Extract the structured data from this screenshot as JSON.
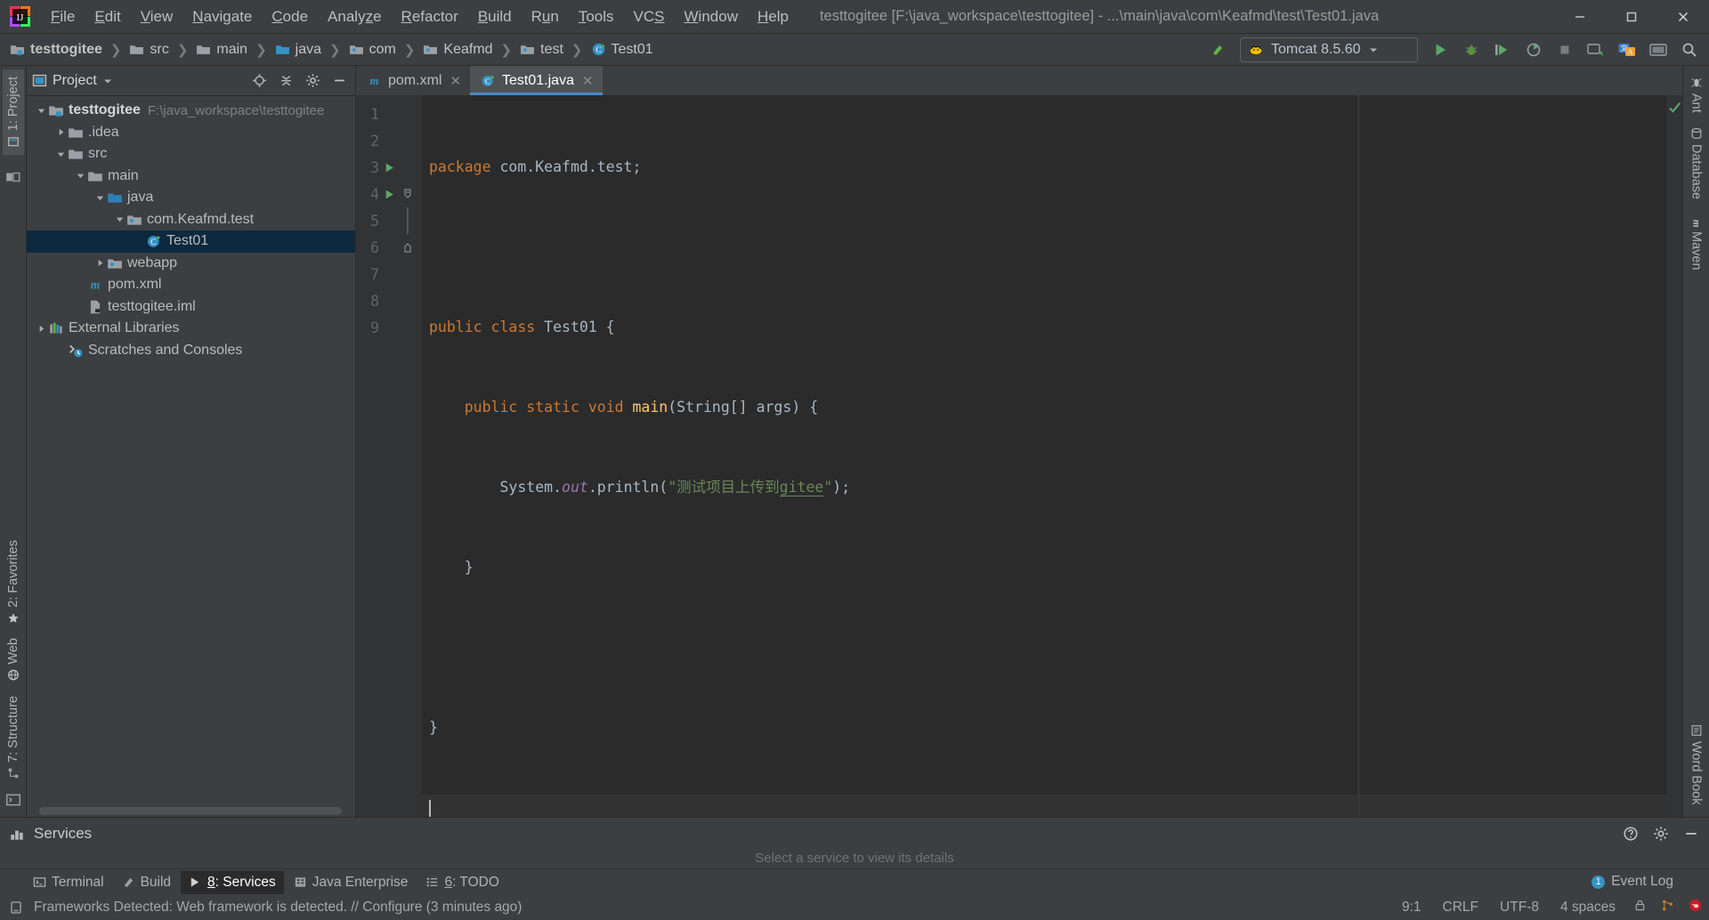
{
  "window": {
    "title": "testtogitee [F:\\java_workspace\\testtogitee] - ...\\main\\java\\com\\Keafmd\\test\\Test01.java",
    "minimize": "—",
    "maximize": "❐",
    "close": "✕"
  },
  "menu": [
    {
      "label": "File",
      "mnemonic": "F"
    },
    {
      "label": "Edit",
      "mnemonic": "E"
    },
    {
      "label": "View",
      "mnemonic": "V"
    },
    {
      "label": "Navigate",
      "mnemonic": "N"
    },
    {
      "label": "Code",
      "mnemonic": "C"
    },
    {
      "label": "Analyze",
      "mnemonic": "z"
    },
    {
      "label": "Refactor",
      "mnemonic": "R"
    },
    {
      "label": "Build",
      "mnemonic": "B"
    },
    {
      "label": "Run",
      "mnemonic": "u"
    },
    {
      "label": "Tools",
      "mnemonic": "T"
    },
    {
      "label": "VCS",
      "mnemonic": "S"
    },
    {
      "label": "Window",
      "mnemonic": "W"
    },
    {
      "label": "Help",
      "mnemonic": "H"
    }
  ],
  "breadcrumb": [
    {
      "label": "testtogitee",
      "icon": "module-icon",
      "bold": true
    },
    {
      "label": "src",
      "icon": "folder-icon",
      "bold": false
    },
    {
      "label": "main",
      "icon": "folder-icon",
      "bold": false
    },
    {
      "label": "java",
      "icon": "source-folder-icon",
      "bold": false
    },
    {
      "label": "com",
      "icon": "package-icon",
      "bold": false
    },
    {
      "label": "Keafmd",
      "icon": "package-icon",
      "bold": false
    },
    {
      "label": "test",
      "icon": "package-icon",
      "bold": false
    },
    {
      "label": "Test01",
      "icon": "java-class-icon",
      "bold": false
    }
  ],
  "toolbar": {
    "build_label": "make-project-icon",
    "run_config": "Tomcat 8.5.60",
    "run_label": "run-icon",
    "debug_label": "debug-icon",
    "run_coverage_label": "run-with-coverage-icon",
    "profile_label": "profile-icon",
    "stop_label": "stop-icon",
    "update_label": "update-app-icon",
    "translate_label": "translate-icon",
    "present_label": "present-icon",
    "search_label": "search-everywhere-icon"
  },
  "project_panel": {
    "title": "Project",
    "buttons": [
      "locate-icon",
      "collapse-all-icon",
      "gear-icon",
      "hide-icon"
    ],
    "tree": [
      {
        "depth": 0,
        "label": "testtogitee",
        "sub": "F:\\java_workspace\\testtogitee",
        "icon": "module-icon",
        "arrow": "down",
        "bold": true,
        "selected": false
      },
      {
        "depth": 1,
        "label": ".idea",
        "sub": "",
        "icon": "folder-icon",
        "arrow": "right",
        "bold": false,
        "selected": false
      },
      {
        "depth": 1,
        "label": "src",
        "sub": "",
        "icon": "folder-icon",
        "arrow": "down",
        "bold": false,
        "selected": false
      },
      {
        "depth": 2,
        "label": "main",
        "sub": "",
        "icon": "folder-icon",
        "arrow": "down",
        "bold": false,
        "selected": false
      },
      {
        "depth": 3,
        "label": "java",
        "sub": "",
        "icon": "source-folder-icon",
        "arrow": "down",
        "bold": false,
        "selected": false
      },
      {
        "depth": 4,
        "label": "com.Keafmd.test",
        "sub": "",
        "icon": "package-icon",
        "arrow": "down",
        "bold": false,
        "selected": false
      },
      {
        "depth": 5,
        "label": "Test01",
        "sub": "",
        "icon": "java-class-icon",
        "arrow": "none",
        "bold": false,
        "selected": true
      },
      {
        "depth": 3,
        "label": "webapp",
        "sub": "",
        "icon": "webapp-folder-icon",
        "arrow": "right",
        "bold": false,
        "selected": false
      },
      {
        "depth": 2,
        "label": "pom.xml",
        "sub": "",
        "icon": "maven-icon",
        "arrow": "none",
        "bold": false,
        "selected": false
      },
      {
        "depth": 2,
        "label": "testtogitee.iml",
        "sub": "",
        "icon": "iml-file-icon",
        "arrow": "none",
        "bold": false,
        "selected": false
      },
      {
        "depth": 0,
        "label": "External Libraries",
        "sub": "",
        "icon": "libraries-icon",
        "arrow": "right",
        "bold": false,
        "selected": false
      },
      {
        "depth": 0,
        "label": "Scratches and Consoles",
        "sub": "",
        "icon": "scratches-icon",
        "arrow": "none",
        "bold": false,
        "selected": false
      }
    ]
  },
  "left_strip": [
    {
      "label": "1: Project",
      "icon": "project-icon",
      "active": true
    },
    {
      "label": "2: Favorites",
      "icon": "favorites-icon",
      "active": false
    },
    {
      "label": "Web",
      "icon": "web-icon",
      "active": false
    },
    {
      "label": "7: Structure",
      "icon": "structure-icon",
      "active": false
    }
  ],
  "right_strip": [
    {
      "label": "Ant",
      "icon": "ant-icon",
      "active": false
    },
    {
      "label": "Database",
      "icon": "database-icon",
      "active": false
    },
    {
      "label": "Maven",
      "icon": "maven-icon",
      "active": false
    },
    {
      "label": "Word Book",
      "icon": "wordbook-icon",
      "active": false
    }
  ],
  "editor": {
    "tabs": [
      {
        "label": "pom.xml",
        "icon": "maven-icon",
        "active": false
      },
      {
        "label": "Test01.java",
        "icon": "java-class-icon",
        "active": true
      }
    ],
    "lines": [
      {
        "num": "1",
        "gutter_mark": "",
        "fold": "",
        "caret": false,
        "tokens": [
          {
            "t": "package ",
            "c": "kw"
          },
          {
            "t": "com.Keafmd.test;",
            "c": "plain"
          }
        ]
      },
      {
        "num": "2",
        "gutter_mark": "",
        "fold": "",
        "caret": false,
        "tokens": []
      },
      {
        "num": "3",
        "gutter_mark": "run",
        "fold": "",
        "caret": false,
        "tokens": [
          {
            "t": "public class ",
            "c": "kw"
          },
          {
            "t": "Test01",
            "c": "class"
          },
          {
            "t": " {",
            "c": "plain"
          }
        ]
      },
      {
        "num": "4",
        "gutter_mark": "run",
        "fold": "foldstart",
        "caret": false,
        "tokens": [
          {
            "t": "    ",
            "c": "plain"
          },
          {
            "t": "public static void ",
            "c": "kw"
          },
          {
            "t": "main",
            "c": "fn"
          },
          {
            "t": "(String[] args) {",
            "c": "plain"
          }
        ]
      },
      {
        "num": "5",
        "gutter_mark": "",
        "fold": "",
        "caret": false,
        "tokens": [
          {
            "t": "        System.",
            "c": "plain"
          },
          {
            "t": "out",
            "c": "static"
          },
          {
            "t": ".println(",
            "c": "plain"
          },
          {
            "t": "\"测试项目上传到",
            "c": "str"
          },
          {
            "t": "gitee",
            "c": "strlink"
          },
          {
            "t": "\"",
            "c": "str"
          },
          {
            "t": ");",
            "c": "plain"
          }
        ]
      },
      {
        "num": "6",
        "gutter_mark": "",
        "fold": "foldend",
        "caret": false,
        "tokens": [
          {
            "t": "    }",
            "c": "plain"
          }
        ]
      },
      {
        "num": "7",
        "gutter_mark": "",
        "fold": "",
        "caret": false,
        "tokens": []
      },
      {
        "num": "8",
        "gutter_mark": "",
        "fold": "",
        "caret": false,
        "tokens": [
          {
            "t": "}",
            "c": "plain"
          }
        ]
      },
      {
        "num": "9",
        "gutter_mark": "",
        "fold": "",
        "caret": true,
        "tokens": []
      }
    ],
    "inspection_status": "no-errors-icon"
  },
  "services": {
    "title": "Services",
    "hint": "Select a service to view its details",
    "buttons": [
      "settings-gear-icon",
      "hide-icon",
      "help-icon"
    ]
  },
  "status_tabs": [
    {
      "label": "Terminal",
      "icon": "terminal-icon",
      "active": false,
      "mnemonic": ""
    },
    {
      "label": "Build",
      "icon": "build-icon",
      "active": false,
      "mnemonic": ""
    },
    {
      "label": "8: Services",
      "icon": "services-icon",
      "active": true,
      "mnemonic": "8"
    },
    {
      "label": "Java Enterprise",
      "icon": "java-enterprise-icon",
      "active": false,
      "mnemonic": ""
    },
    {
      "label": "6: TODO",
      "icon": "todo-icon",
      "active": false,
      "mnemonic": "6"
    }
  ],
  "statusbar": {
    "message": "Frameworks Detected: Web framework is detected. // Configure (3 minutes ago)",
    "position": "9:1",
    "line_separator": "CRLF",
    "encoding": "UTF-8",
    "indent": "4 spaces",
    "event_log": "Event Log",
    "event_count": "1",
    "icons": [
      "lock-icon",
      "git-branch-icon",
      "gitee-icon"
    ]
  },
  "colors": {
    "accent": "#4a88c7",
    "selection": "#0d293e",
    "panel_bg": "#3c3f41",
    "editor_bg": "#2b2b2b",
    "gutter_bg": "#313335",
    "keyword": "#cc7832",
    "string": "#6a8759",
    "method": "#ffc66d",
    "static_field": "#9876aa",
    "default_text": "#a9b7c6",
    "run_green": "#59a869",
    "folder": "#8f8f8f",
    "source_folder": "#3592c4"
  }
}
